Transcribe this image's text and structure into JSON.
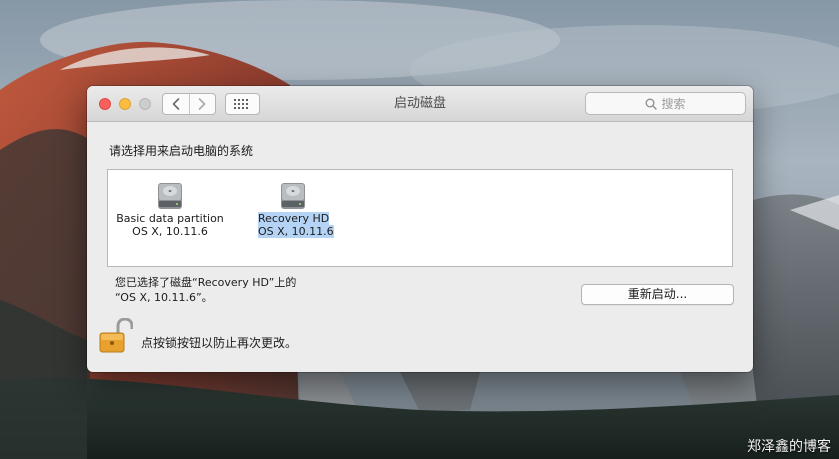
{
  "window": {
    "title": "启动磁盘",
    "search_placeholder": "搜索"
  },
  "prompt": "请选择用来启动电脑的系统",
  "disks": [
    {
      "name": "Basic data partition",
      "os": "OS X, 10.11.6",
      "selected": false
    },
    {
      "name": "Recovery HD",
      "os": "OS X, 10.11.6",
      "selected": true
    }
  ],
  "status": {
    "line1": "您已选择了磁盘“Recovery HD”上的",
    "line2": "“OS X, 10.11.6”。"
  },
  "restart_label": "重新启动...",
  "lock_text": "点按锁按钮以防止再次更改。",
  "watermark": "郑泽鑫的博客",
  "colors": {
    "close": "#fc605c",
    "minimize": "#fdbc40",
    "zoom_disabled": "#cdcdcd",
    "selection": "#b4d3f5",
    "lock_gold": "#e9a12e"
  },
  "icons": [
    "back-chevron-icon",
    "forward-chevron-icon",
    "grid-icon",
    "search-icon",
    "hard-disk-icon",
    "unlocked-padlock-icon"
  ]
}
